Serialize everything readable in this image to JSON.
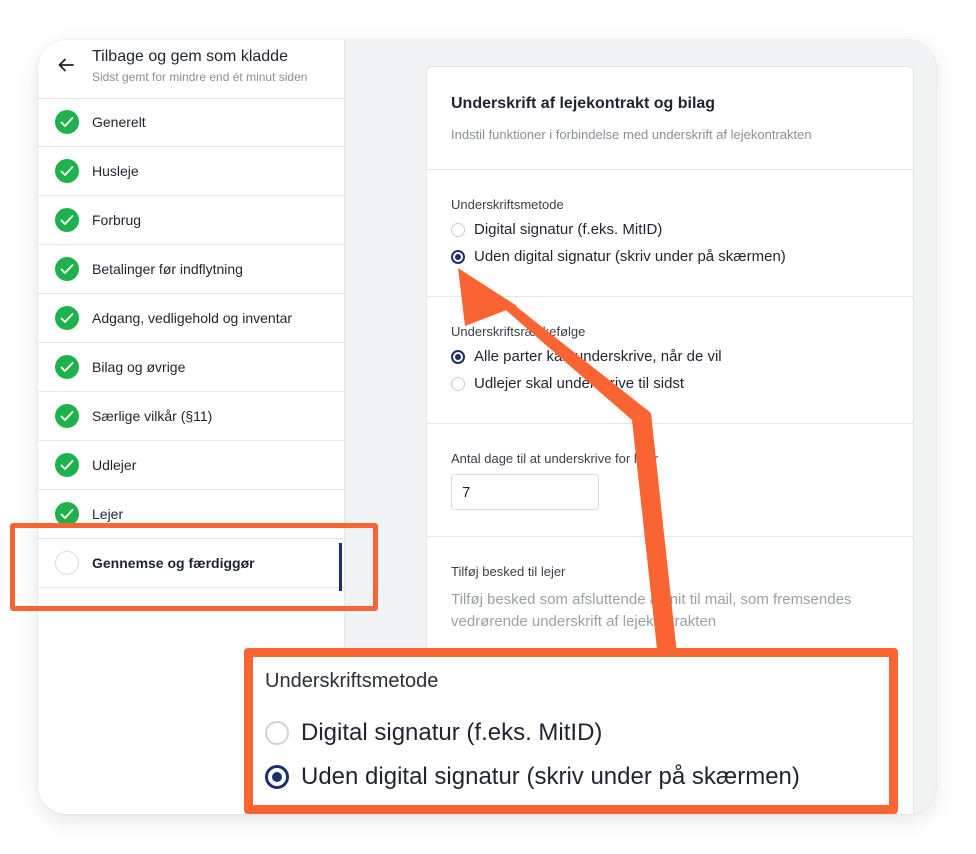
{
  "header": {
    "back_label": "Tilbage og gem som kladde",
    "saved_status": "Sidst gemt for mindre end ét minut siden"
  },
  "steps": [
    {
      "label": "Generelt",
      "done": true
    },
    {
      "label": "Husleje",
      "done": true
    },
    {
      "label": "Forbrug",
      "done": true
    },
    {
      "label": "Betalinger før indflytning",
      "done": true
    },
    {
      "label": "Adgang, vedligehold og inventar",
      "done": true
    },
    {
      "label": "Bilag og øvrige",
      "done": true
    },
    {
      "label": "Særlige vilkår (§11)",
      "done": true
    },
    {
      "label": "Udlejer",
      "done": true
    },
    {
      "label": "Lejer",
      "done": true
    },
    {
      "label": "Gennemse og færdiggør",
      "done": false,
      "active": true
    }
  ],
  "card": {
    "title": "Underskrift af lejekontrakt og bilag",
    "description": "Indstil funktioner i forbindelse med underskrift af lejekontrakten",
    "signature_method": {
      "label": "Underskriftsmetode",
      "options": [
        "Digital signatur (f.eks. MitID)",
        "Uden digital signatur (skriv under på skærmen)"
      ],
      "selected": "Uden digital signatur (skriv under på skærmen)"
    },
    "signature_order": {
      "label": "Underskriftsrækkefølge",
      "options": [
        "Alle parter kan underskrive, når de vil",
        "Udlejer skal underskrive til sidst"
      ],
      "selected": "Alle parter kan underskrive, når de vil"
    },
    "days_to_sign": {
      "label": "Antal dage til at underskrive for lejer",
      "value": "7"
    },
    "message": {
      "label": "Tilføj besked til lejer",
      "hint": "Tilføj besked som afsluttende afsnit til mail, som fremsendes vedrørende underskrift af lejekontrakten"
    }
  },
  "zoom": {
    "label": "Underskriftsmetode",
    "options": [
      "Digital signatur (f.eks. MitID)",
      "Uden digital signatur (skriv under på skærmen)"
    ]
  },
  "colors": {
    "accent": "#fa6432",
    "primary": "#1c2e6b",
    "success": "#1fb14c"
  }
}
